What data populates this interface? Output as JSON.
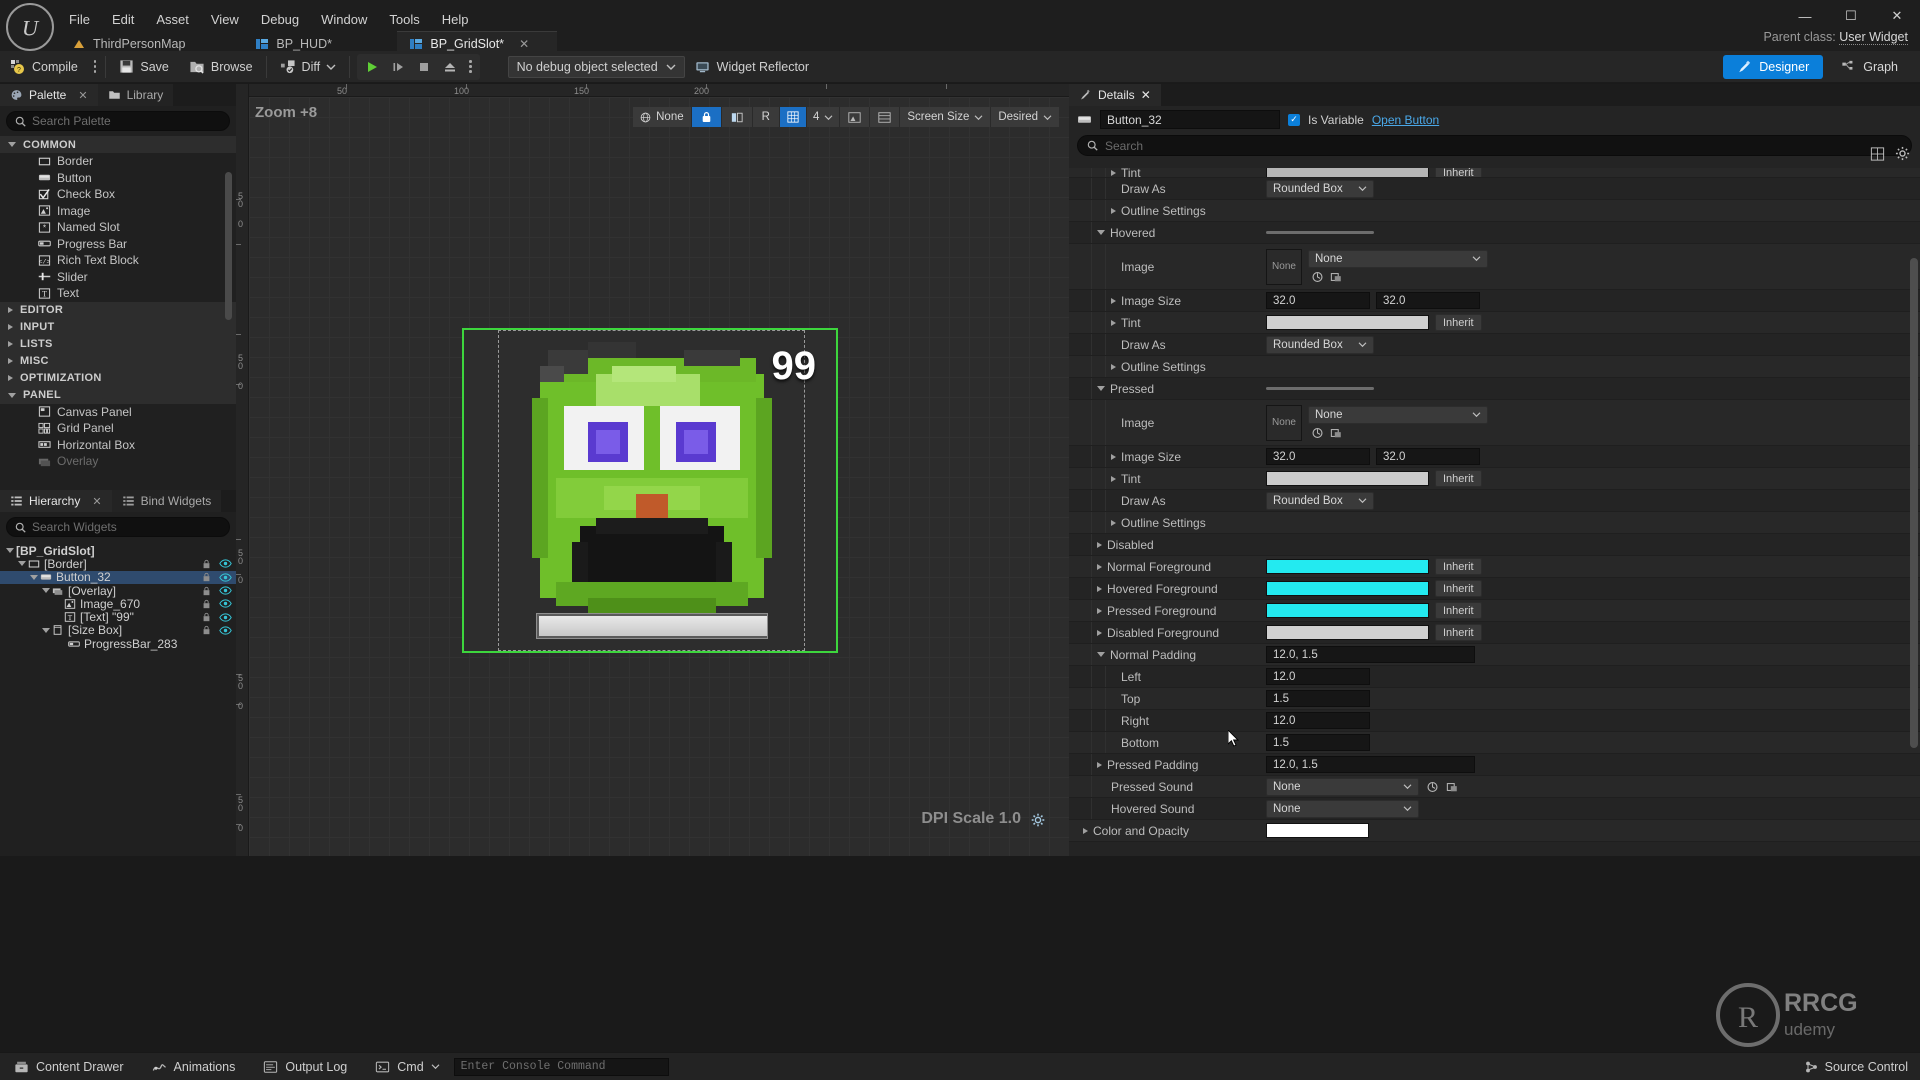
{
  "app": {
    "title": "Unreal Editor",
    "parent_class_label": "Parent class:",
    "parent_class_value": "User Widget"
  },
  "menubar": {
    "items": [
      "File",
      "Edit",
      "Asset",
      "View",
      "Debug",
      "Window",
      "Tools",
      "Help"
    ]
  },
  "window_controls": {
    "minimize": "—",
    "maximize": "☐",
    "close": "✕"
  },
  "asset_tabs": [
    {
      "label": "ThirdPersonMap",
      "icon": "level-icon",
      "active": false,
      "closable": false
    },
    {
      "label": "BP_HUD*",
      "icon": "widget-blueprint-icon",
      "active": false,
      "closable": false
    },
    {
      "label": "BP_GridSlot*",
      "icon": "widget-blueprint-icon",
      "active": true,
      "closable": true,
      "close": "✕"
    }
  ],
  "toolbar": {
    "compile": "Compile",
    "save": "Save",
    "browse": "Browse",
    "diff": "Diff",
    "debug_object": "No debug object selected",
    "widget_reflector": "Widget Reflector",
    "mode_designer": "Designer",
    "mode_graph": "Graph"
  },
  "palette": {
    "tabs": [
      {
        "label": "Palette",
        "icon": "palette-icon",
        "active": true,
        "close": "✕"
      },
      {
        "label": "Library",
        "icon": "folder-icon",
        "active": false
      }
    ],
    "search_placeholder": "Search Palette",
    "categories": [
      {
        "name": "COMMON",
        "expanded": true,
        "items": [
          {
            "label": "Border",
            "icon": "border-icon"
          },
          {
            "label": "Button",
            "icon": "button-icon"
          },
          {
            "label": "Check Box",
            "icon": "checkbox-icon"
          },
          {
            "label": "Image",
            "icon": "image-icon"
          },
          {
            "label": "Named Slot",
            "icon": "named-slot-icon"
          },
          {
            "label": "Progress Bar",
            "icon": "progress-bar-icon"
          },
          {
            "label": "Rich Text Block",
            "icon": "rich-text-icon"
          },
          {
            "label": "Slider",
            "icon": "slider-icon"
          },
          {
            "label": "Text",
            "icon": "text-icon"
          }
        ]
      },
      {
        "name": "EDITOR",
        "expanded": false,
        "items": []
      },
      {
        "name": "INPUT",
        "expanded": false,
        "items": []
      },
      {
        "name": "LISTS",
        "expanded": false,
        "items": []
      },
      {
        "name": "MISC",
        "expanded": false,
        "items": []
      },
      {
        "name": "OPTIMIZATION",
        "expanded": false,
        "items": []
      },
      {
        "name": "PANEL",
        "expanded": true,
        "items": [
          {
            "label": "Canvas Panel",
            "icon": "canvas-panel-icon"
          },
          {
            "label": "Grid Panel",
            "icon": "grid-panel-icon"
          },
          {
            "label": "Horizontal Box",
            "icon": "horizontal-box-icon"
          },
          {
            "label": "Overlay",
            "icon": "overlay-icon"
          }
        ]
      }
    ]
  },
  "hierarchy": {
    "tabs": [
      {
        "label": "Hierarchy",
        "icon": "hierarchy-icon",
        "active": true,
        "close": "✕"
      },
      {
        "label": "Bind Widgets",
        "icon": "bind-widgets-icon",
        "active": false
      }
    ],
    "search_placeholder": "Search Widgets",
    "nodes": [
      {
        "label": "[BP_GridSlot]",
        "depth": 0,
        "caret": "down",
        "icon": "",
        "selected": false,
        "locks": false
      },
      {
        "label": "[Border]",
        "depth": 1,
        "caret": "down",
        "icon": "border-icon",
        "selected": false,
        "locks": true
      },
      {
        "label": "Button_32",
        "depth": 2,
        "caret": "down",
        "icon": "button-icon",
        "selected": true,
        "locks": true
      },
      {
        "label": "[Overlay]",
        "depth": 3,
        "caret": "down",
        "icon": "overlay-icon",
        "selected": false,
        "locks": true
      },
      {
        "label": "Image_670",
        "depth": 4,
        "caret": "none",
        "icon": "image-icon",
        "selected": false,
        "locks": true
      },
      {
        "label": "[Text] \"99\"",
        "depth": 4,
        "caret": "none",
        "icon": "text-icon",
        "selected": false,
        "locks": true
      },
      {
        "label": "[Size Box]",
        "depth": 3,
        "caret": "down",
        "icon": "size-box-icon",
        "selected": false,
        "locks": true
      },
      {
        "label": "ProgressBar_283",
        "depth": 4,
        "caret": "none",
        "icon": "progress-bar-icon",
        "selected": false,
        "locks": false
      }
    ]
  },
  "canvas": {
    "zoom_label": "Zoom +8",
    "dpi_label": "DPI Scale 1.0",
    "ruler_x_ticks": [
      "50",
      "100",
      "150",
      "200"
    ],
    "ruler_y_ticks": [
      "50",
      "0",
      "50",
      "0",
      "50",
      "0",
      "50",
      "0",
      "50",
      "0",
      "20"
    ],
    "toolbar": {
      "snap_none": "None",
      "lock_icon": "lock-icon",
      "fill_screen_icon": "fill-screen-icon",
      "resize_r": "R",
      "grid_icon": "grid-icon",
      "grid_value": "4",
      "grid_dropdown_icon": "chevron-down-icon",
      "image_icon": "image-preview-icon",
      "layers_icon": "layers-icon",
      "screen_size": "Screen Size",
      "desired": "Desired"
    },
    "preview": {
      "badge_number": "99",
      "selection_color": "#3dd63d"
    }
  },
  "details": {
    "tab_label": "Details",
    "tab_close": "✕",
    "object_name": "Button_32",
    "is_variable_label": "Is Variable",
    "is_variable_checked": true,
    "open_button_label": "Open Button",
    "search_placeholder": "Search",
    "rows": [
      {
        "id": "tint-top",
        "label": "Tint",
        "indent": 1,
        "caret": "right",
        "type": "swatch-inherit",
        "swatch": "#b6b6b6",
        "inherit": "Inherit",
        "cut": true
      },
      {
        "id": "draw-as-1",
        "label": "Draw As",
        "indent": 2,
        "caret": "none",
        "type": "dropdown",
        "value": "Rounded Box"
      },
      {
        "id": "outline-1",
        "label": "Outline Settings",
        "indent": 1,
        "caret": "right",
        "type": "none"
      },
      {
        "id": "hovered",
        "label": "Hovered",
        "indent": 0,
        "caret": "down",
        "type": "bar"
      },
      {
        "id": "image-hovered",
        "label": "Image",
        "indent": 2,
        "caret": "none",
        "type": "asset",
        "thumb": "None",
        "value": "None"
      },
      {
        "id": "image-size-hovered",
        "label": "Image Size",
        "indent": 1,
        "caret": "right",
        "type": "two-num",
        "value": "32.0",
        "value2": "32.0"
      },
      {
        "id": "tint-hovered",
        "label": "Tint",
        "indent": 1,
        "caret": "right",
        "type": "swatch-inherit",
        "swatch": "#cfcfcf",
        "inherit": "Inherit"
      },
      {
        "id": "draw-as-hovered",
        "label": "Draw As",
        "indent": 2,
        "caret": "none",
        "type": "dropdown",
        "value": "Rounded Box"
      },
      {
        "id": "outline-hovered",
        "label": "Outline Settings",
        "indent": 1,
        "caret": "right",
        "type": "none"
      },
      {
        "id": "pressed",
        "label": "Pressed",
        "indent": 0,
        "caret": "down",
        "type": "bar"
      },
      {
        "id": "image-pressed",
        "label": "Image",
        "indent": 2,
        "caret": "none",
        "type": "asset",
        "thumb": "None",
        "value": "None"
      },
      {
        "id": "image-size-pressed",
        "label": "Image Size",
        "indent": 1,
        "caret": "right",
        "type": "two-num",
        "value": "32.0",
        "value2": "32.0"
      },
      {
        "id": "tint-pressed",
        "label": "Tint",
        "indent": 1,
        "caret": "right",
        "type": "swatch-inherit",
        "swatch": "#cbcbcb",
        "inherit": "Inherit"
      },
      {
        "id": "draw-as-pressed",
        "label": "Draw As",
        "indent": 2,
        "caret": "none",
        "type": "dropdown",
        "value": "Rounded Box"
      },
      {
        "id": "outline-pressed",
        "label": "Outline Settings",
        "indent": 1,
        "caret": "right",
        "type": "none"
      },
      {
        "id": "disabled",
        "label": "Disabled",
        "indent": 0,
        "caret": "right",
        "type": "none"
      },
      {
        "id": "normal-fg",
        "label": "Normal Foreground",
        "indent": 0,
        "caret": "right",
        "type": "swatch-inherit",
        "swatch": "#23eaf0",
        "inherit": "Inherit"
      },
      {
        "id": "hovered-fg",
        "label": "Hovered Foreground",
        "indent": 0,
        "caret": "right",
        "type": "swatch-inherit",
        "swatch": "#23eaf0",
        "inherit": "Inherit"
      },
      {
        "id": "pressed-fg",
        "label": "Pressed Foreground",
        "indent": 0,
        "caret": "right",
        "type": "swatch-inherit",
        "swatch": "#23eaf0",
        "inherit": "Inherit"
      },
      {
        "id": "disabled-fg",
        "label": "Disabled Foreground",
        "indent": 0,
        "caret": "right",
        "type": "swatch-inherit",
        "swatch": "#d0d0d0",
        "inherit": "Inherit"
      },
      {
        "id": "normal-padding",
        "label": "Normal Padding",
        "indent": 0,
        "caret": "down",
        "type": "text",
        "value": "12.0, 1.5"
      },
      {
        "id": "padding-left",
        "label": "Left",
        "indent": 2,
        "caret": "none",
        "type": "num",
        "value": "12.0"
      },
      {
        "id": "padding-top",
        "label": "Top",
        "indent": 2,
        "caret": "none",
        "type": "num",
        "value": "1.5"
      },
      {
        "id": "padding-right",
        "label": "Right",
        "indent": 2,
        "caret": "none",
        "type": "num",
        "value": "12.0"
      },
      {
        "id": "padding-bottom",
        "label": "Bottom",
        "indent": 2,
        "caret": "none",
        "type": "num",
        "value": "1.5"
      },
      {
        "id": "pressed-padding",
        "label": "Pressed Padding",
        "indent": 0,
        "caret": "right",
        "type": "text",
        "value": "12.0, 1.5"
      },
      {
        "id": "pressed-sound",
        "label": "Pressed Sound",
        "indent": 1,
        "caret": "none",
        "type": "asset-dd",
        "value": "None"
      },
      {
        "id": "hovered-sound",
        "label": "Hovered Sound",
        "indent": 1,
        "caret": "none",
        "type": "asset-dd",
        "value": "None"
      },
      {
        "id": "color-and-opacity",
        "label": "Color and Opacity",
        "indent": 0,
        "caret": "right",
        "type": "swatch",
        "swatch": "#ffffff"
      }
    ]
  },
  "bottombar": {
    "content_drawer": "Content Drawer",
    "animations": "Animations",
    "output_log": "Output Log",
    "cmd": "Cmd",
    "console_placeholder": "Enter Console Command",
    "source_control": "Source Control"
  }
}
